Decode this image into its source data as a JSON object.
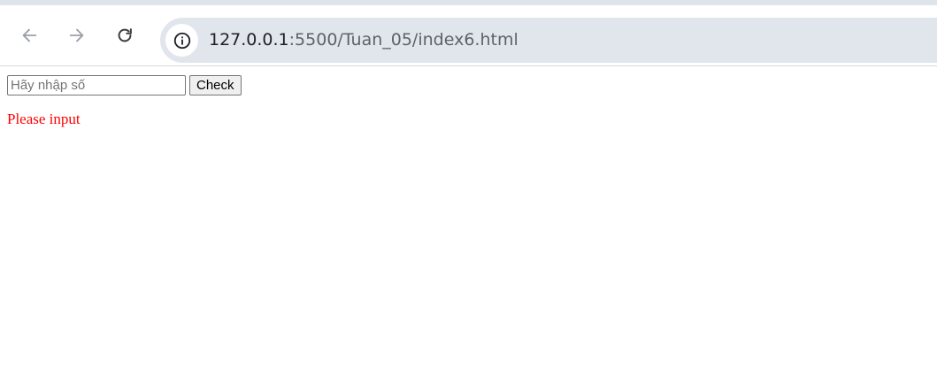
{
  "browser": {
    "url_host": "127.0.0.1",
    "url_rest": ":5500/Tuan_05/index6.html",
    "icons": {
      "back": "arrow-left-icon",
      "forward": "arrow-right-icon",
      "reload": "reload-icon",
      "site_info": "info-icon"
    }
  },
  "page": {
    "input_placeholder": "Hãy nhập số",
    "input_value": "",
    "check_label": "Check",
    "message": "Please input",
    "message_color": "#ff0000"
  }
}
